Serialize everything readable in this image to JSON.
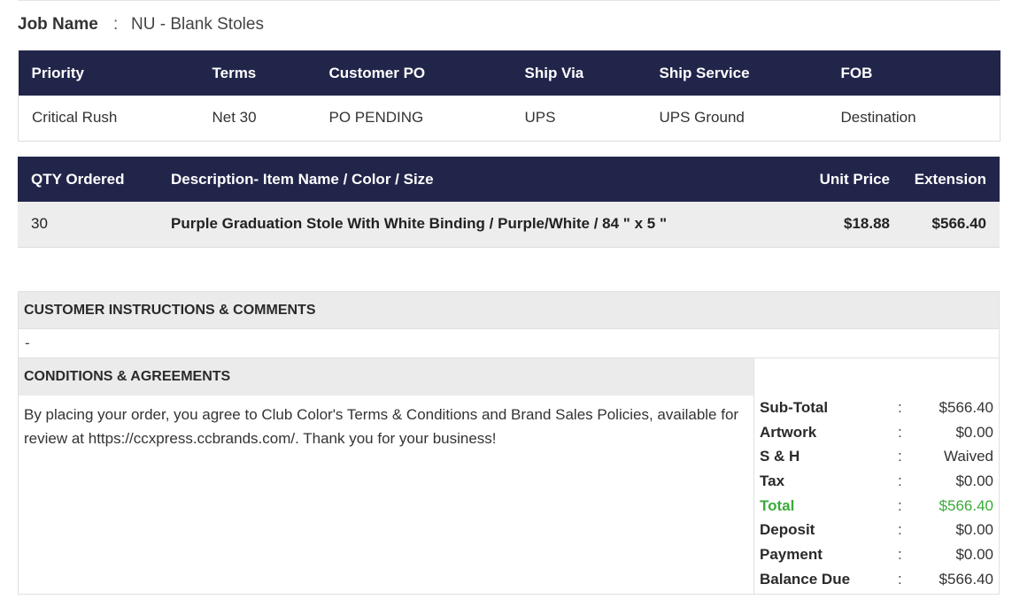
{
  "job": {
    "label": "Job Name",
    "separator": ":",
    "value": "NU - Blank Stoles"
  },
  "order_info": {
    "headers": [
      "Priority",
      "Terms",
      "Customer PO",
      "Ship Via",
      "Ship Service",
      "FOB"
    ],
    "values": [
      "Critical Rush",
      "Net 30",
      "PO PENDING",
      "UPS",
      "UPS Ground",
      "Destination"
    ]
  },
  "items": {
    "headers": [
      "QTY Ordered",
      "Description- Item Name / Color / Size",
      "Unit Price",
      "Extension"
    ],
    "rows": [
      {
        "qty": "30",
        "description": "Purple Graduation Stole With White Binding / Purple/White / 84 \" x 5 \"",
        "unit_price": "$18.88",
        "extension": "$566.40"
      }
    ]
  },
  "instructions": {
    "title": "CUSTOMER INSTRUCTIONS & COMMENTS",
    "text": "-"
  },
  "conditions": {
    "title": "CONDITIONS & AGREEMENTS",
    "text": "By placing your order, you agree to Club Color's Terms & Conditions and Brand Sales Policies, available for review at https://ccxpress.ccbrands.com/. Thank you for your business!"
  },
  "totals": {
    "separator": ":",
    "rows": [
      {
        "label": "Sub-Total",
        "value": "$566.40"
      },
      {
        "label": "Artwork",
        "value": "$0.00"
      },
      {
        "label": "S & H",
        "value": "Waived"
      },
      {
        "label": "Tax",
        "value": "$0.00"
      },
      {
        "label": "Total",
        "value": "$566.40"
      },
      {
        "label": "Deposit",
        "value": "$0.00"
      },
      {
        "label": "Payment",
        "value": "$0.00"
      },
      {
        "label": "Balance Due",
        "value": "$566.40"
      }
    ]
  },
  "colors": {
    "header_bg": "#22254a",
    "total_accent": "#3aaa3a",
    "section_bg": "#ebebeb"
  }
}
